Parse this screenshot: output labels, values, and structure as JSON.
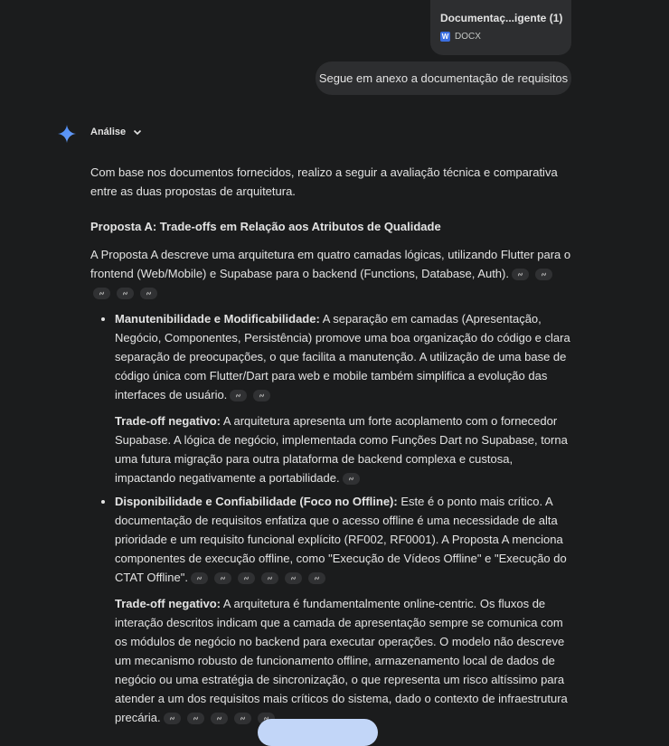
{
  "attachment": {
    "name": "Documentaç...igente (1)",
    "type": "DOCX",
    "icon": "word-icon"
  },
  "user_message": "Segue em anexo a documentação de requisitos",
  "analysis_label": "Análise",
  "intro": "Com base nos documentos fornecidos, realizo a seguir a avaliação técnica e comparativa entre as duas propostas de arquitetura.",
  "heading": "Proposta A: Trade-offs em Relação aos Atributos de Qualidade",
  "paragraph": "A Proposta A descreve uma arquitetura em quatro camadas lógicas, utilizando Flutter para o frontend (Web/Mobile) e Supabase para o backend (Functions, Database, Auth).",
  "bullets": [
    {
      "title": "Manutenibilidade e Modificabilidade:",
      "text": " A separação em camadas (Apresentação, Negócio, Componentes, Persistência) promove uma boa organização do código e clara separação de preocupações, o que facilita a manutenção. A utilização de uma base de código única com Flutter/Dart para web e mobile também simplifica a evolução das interfaces de usuário.",
      "sub_title": "Trade-off negativo:",
      "sub_text": " A arquitetura apresenta um forte acoplamento com o fornecedor Supabase. A lógica de negócio, implementada como Funções Dart no Supabase, torna uma futura migração para outra plataforma de backend complexa e custosa, impactando negativamente a portabilidade."
    },
    {
      "title": "Disponibilidade e Confiabilidade (Foco no Offline):",
      "text": " Este é o ponto mais crítico. A documentação de requisitos enfatiza que o acesso offline é uma necessidade de alta prioridade e um requisito funcional explícito (RF002, RF0001). A Proposta A menciona componentes de execução offline, como \"Execução de Vídeos Offline\" e \"Execução do CTAT Offline\".",
      "sub_title": "Trade-off negativo:",
      "sub_text": " A arquitetura é fundamentalmente online-centric. Os fluxos de interação descritos indicam que a camada de apresentação sempre se comunica com os módulos de negócio no backend para executar operações. O modelo não descreve um mecanismo robusto de funcionamento offline, armazenamento local de dados de negócio ou uma estratégia de sincronização, o que representa um risco altíssimo para atender a um dos requisitos mais críticos do sistema, dado o contexto de infraestrutura precária."
    }
  ],
  "colors": {
    "background": "#1b1c1d",
    "bubble": "#2d2e30",
    "accent": "#4a8af4"
  }
}
